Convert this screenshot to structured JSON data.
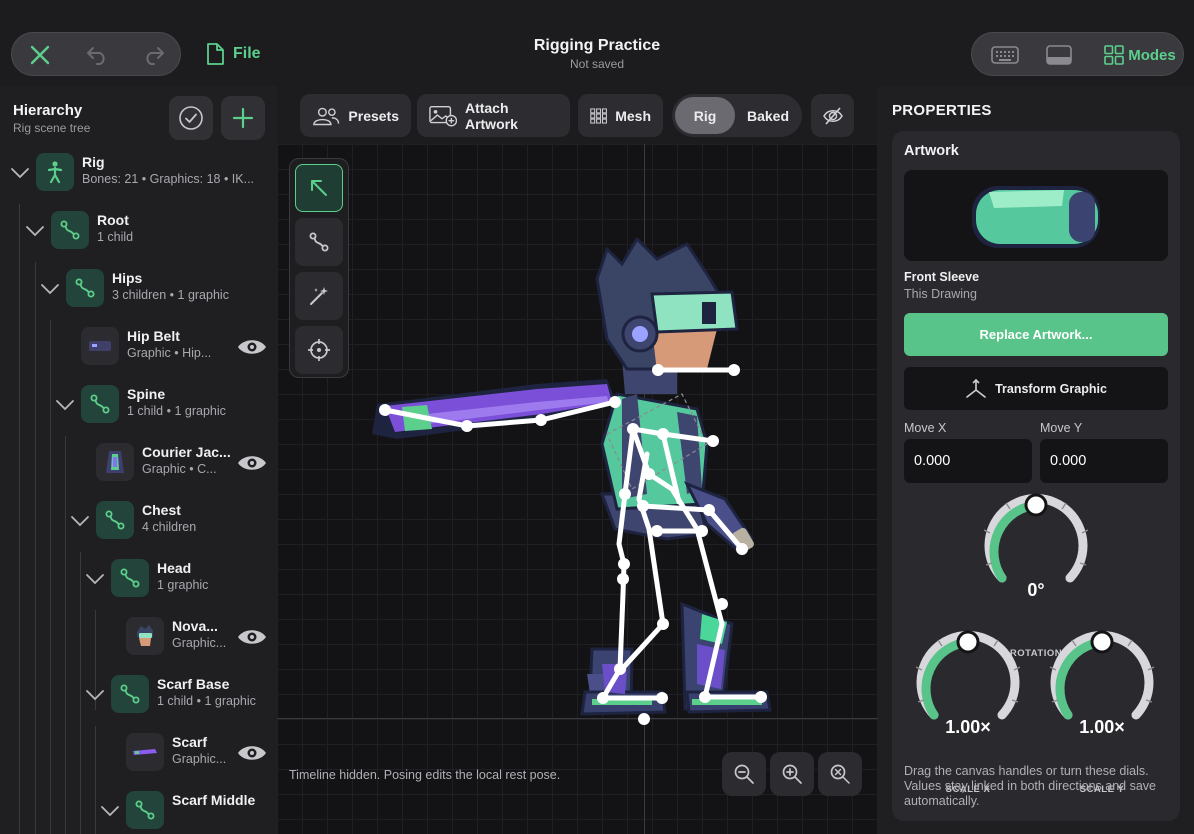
{
  "topbar": {
    "file_label": "File",
    "title": "Rigging Practice",
    "subtitle": "Not saved",
    "modes_label": "Modes"
  },
  "hierarchy": {
    "title": "Hierarchy",
    "subtitle": "Rig scene tree",
    "rows": [
      {
        "name": "Rig",
        "meta": "Bones: 21  •  Graphics: 18  •  IK..."
      },
      {
        "name": "Root",
        "meta": "1 child"
      },
      {
        "name": "Hips",
        "meta": "3 children  •  1 graphic"
      },
      {
        "name": "Hip Belt",
        "meta": "Graphic  •  Hip..."
      },
      {
        "name": "Spine",
        "meta": "1 child  •  1 graphic"
      },
      {
        "name": "Courier Jac...",
        "meta": "Graphic  •  C..."
      },
      {
        "name": "Chest",
        "meta": "4 children"
      },
      {
        "name": "Head",
        "meta": "1 graphic"
      },
      {
        "name": "Nova...",
        "meta": "Graphic..."
      },
      {
        "name": "Scarf Base",
        "meta": "1 child  •  1 graphic"
      },
      {
        "name": "Scarf",
        "meta": "Graphic..."
      },
      {
        "name": "Scarf Middle",
        "meta": ""
      }
    ]
  },
  "toolbar": {
    "presets": "Presets",
    "attach": "Attach Artwork",
    "mesh": "Mesh",
    "rig": "Rig",
    "baked": "Baked",
    "active_mode": "Rig"
  },
  "canvas": {
    "hint": "Timeline hidden. Posing edits the local rest pose."
  },
  "properties": {
    "title": "PROPERTIES",
    "card_title": "Artwork",
    "artwork_name": "Front Sleeve",
    "artwork_source": "This Drawing",
    "replace_label": "Replace Artwork...",
    "transform_label": "Transform Graphic",
    "move_x_label": "Move X",
    "move_y_label": "Move Y",
    "move_x": "0.000",
    "move_y": "0.000",
    "rotation_value": "0°",
    "rotation_label": "ROTATION",
    "scale_x_value": "1.00×",
    "scale_x_label": "SCALE X",
    "scale_y_value": "1.00×",
    "scale_y_label": "SCALE Y",
    "help": "Drag the canvas handles or turn these dials. Values stay linked in both directions and save automatically."
  },
  "colors": {
    "accent": "#5ccf8d",
    "panel": "#1f1f22",
    "bone": "#ffffff"
  }
}
